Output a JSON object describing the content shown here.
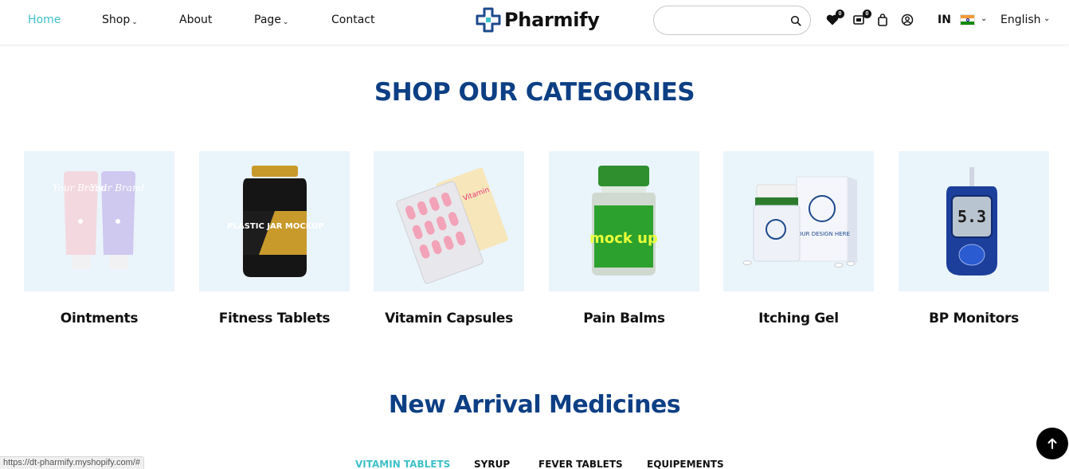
{
  "nav": {
    "items": [
      {
        "label": "Home",
        "dropdown": false,
        "active": true
      },
      {
        "label": "Shop",
        "dropdown": true
      },
      {
        "label": "About",
        "dropdown": false
      },
      {
        "label": "Page",
        "dropdown": true
      },
      {
        "label": "Contact",
        "dropdown": false
      }
    ]
  },
  "brand": {
    "name": "Pharmify",
    "color": "#1d4a8c"
  },
  "search": {
    "placeholder": "",
    "value": ""
  },
  "header_icons": {
    "wishlist_count": "0",
    "compare_count": "0"
  },
  "locale": {
    "country": "IN",
    "language": "English"
  },
  "categories_section": {
    "title": "SHOP OUR CATEGORIES",
    "items": [
      {
        "name": "Ointments"
      },
      {
        "name": "Fitness Tablets"
      },
      {
        "name": "Vitamin Capsules"
      },
      {
        "name": "Pain Balms"
      },
      {
        "name": "Itching Gel"
      },
      {
        "name": "BP Monitors"
      }
    ]
  },
  "product_images": {
    "ointment_tube_text": "Your Brand",
    "jar_text": "PLASTIC JAR MOCKUP",
    "blister_text": "Multi Vitamin",
    "bottle_text": "mock up",
    "box_text": "YOUR DESIGN HERE",
    "monitor_reading": "5.3"
  },
  "new_arrivals": {
    "title": "New Arrival Medicines",
    "tabs": [
      {
        "label": "VITAMIN TABLETS",
        "active": true
      },
      {
        "label": "SYRUP"
      },
      {
        "label": "FEVER TABLETS"
      },
      {
        "label": "EQUIPEMENTS"
      }
    ]
  },
  "status_bar": {
    "url": "https://dt-pharmify.myshopify.com/#"
  },
  "colors": {
    "accent": "#3ec0c8",
    "heading": "#0d3f84",
    "card_bg": "#eaf4fb"
  }
}
